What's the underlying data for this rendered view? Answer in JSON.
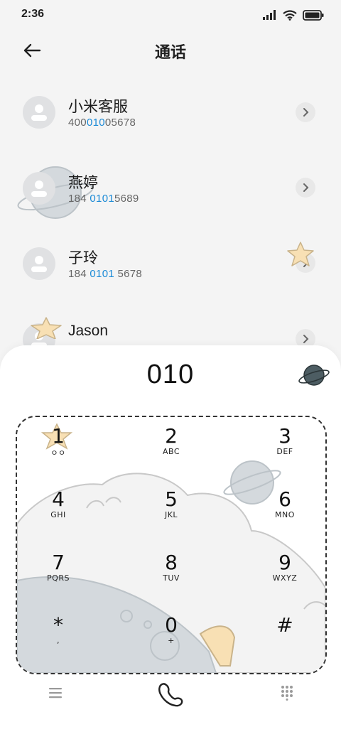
{
  "status_bar": {
    "time": "2:36"
  },
  "header": {
    "title": "通话"
  },
  "contacts": [
    {
      "name": "小米客服",
      "number_pre": "400",
      "number_hl": "010",
      "number_post": "05678"
    },
    {
      "name": "燕婷",
      "number_pre": "184 ",
      "number_hl": "0101",
      "number_post": "5689"
    },
    {
      "name": "子玲",
      "number_pre": "184 ",
      "number_hl": "0101",
      "number_post": " 5678"
    },
    {
      "name": "Jason",
      "number_pre": "",
      "number_hl": "",
      "number_post": ""
    }
  ],
  "dialpad": {
    "display": "010",
    "keys": [
      {
        "digit": "1",
        "letters": "ㅇㅇ"
      },
      {
        "digit": "2",
        "letters": "ABC"
      },
      {
        "digit": "3",
        "letters": "DEF"
      },
      {
        "digit": "4",
        "letters": "GHI"
      },
      {
        "digit": "5",
        "letters": "JKL"
      },
      {
        "digit": "6",
        "letters": "MNO"
      },
      {
        "digit": "7",
        "letters": "PQRS"
      },
      {
        "digit": "8",
        "letters": "TUV"
      },
      {
        "digit": "9",
        "letters": "WXYZ"
      },
      {
        "digit": "*",
        "letters": ","
      },
      {
        "digit": "0",
        "letters": "+"
      },
      {
        "digit": "#",
        "letters": ""
      }
    ]
  },
  "colors": {
    "highlight": "#1b8ad6",
    "avatar": "#e0e1e3",
    "planet": "#d3d8dc",
    "star": "#f8e0b4"
  },
  "icons": [
    "back-arrow-icon",
    "chevron-right-icon",
    "person-icon",
    "menu-icon",
    "phone-icon",
    "dialpad-icon",
    "planet-icon",
    "star-icon",
    "signal-icon",
    "wifi-icon",
    "battery-icon"
  ]
}
